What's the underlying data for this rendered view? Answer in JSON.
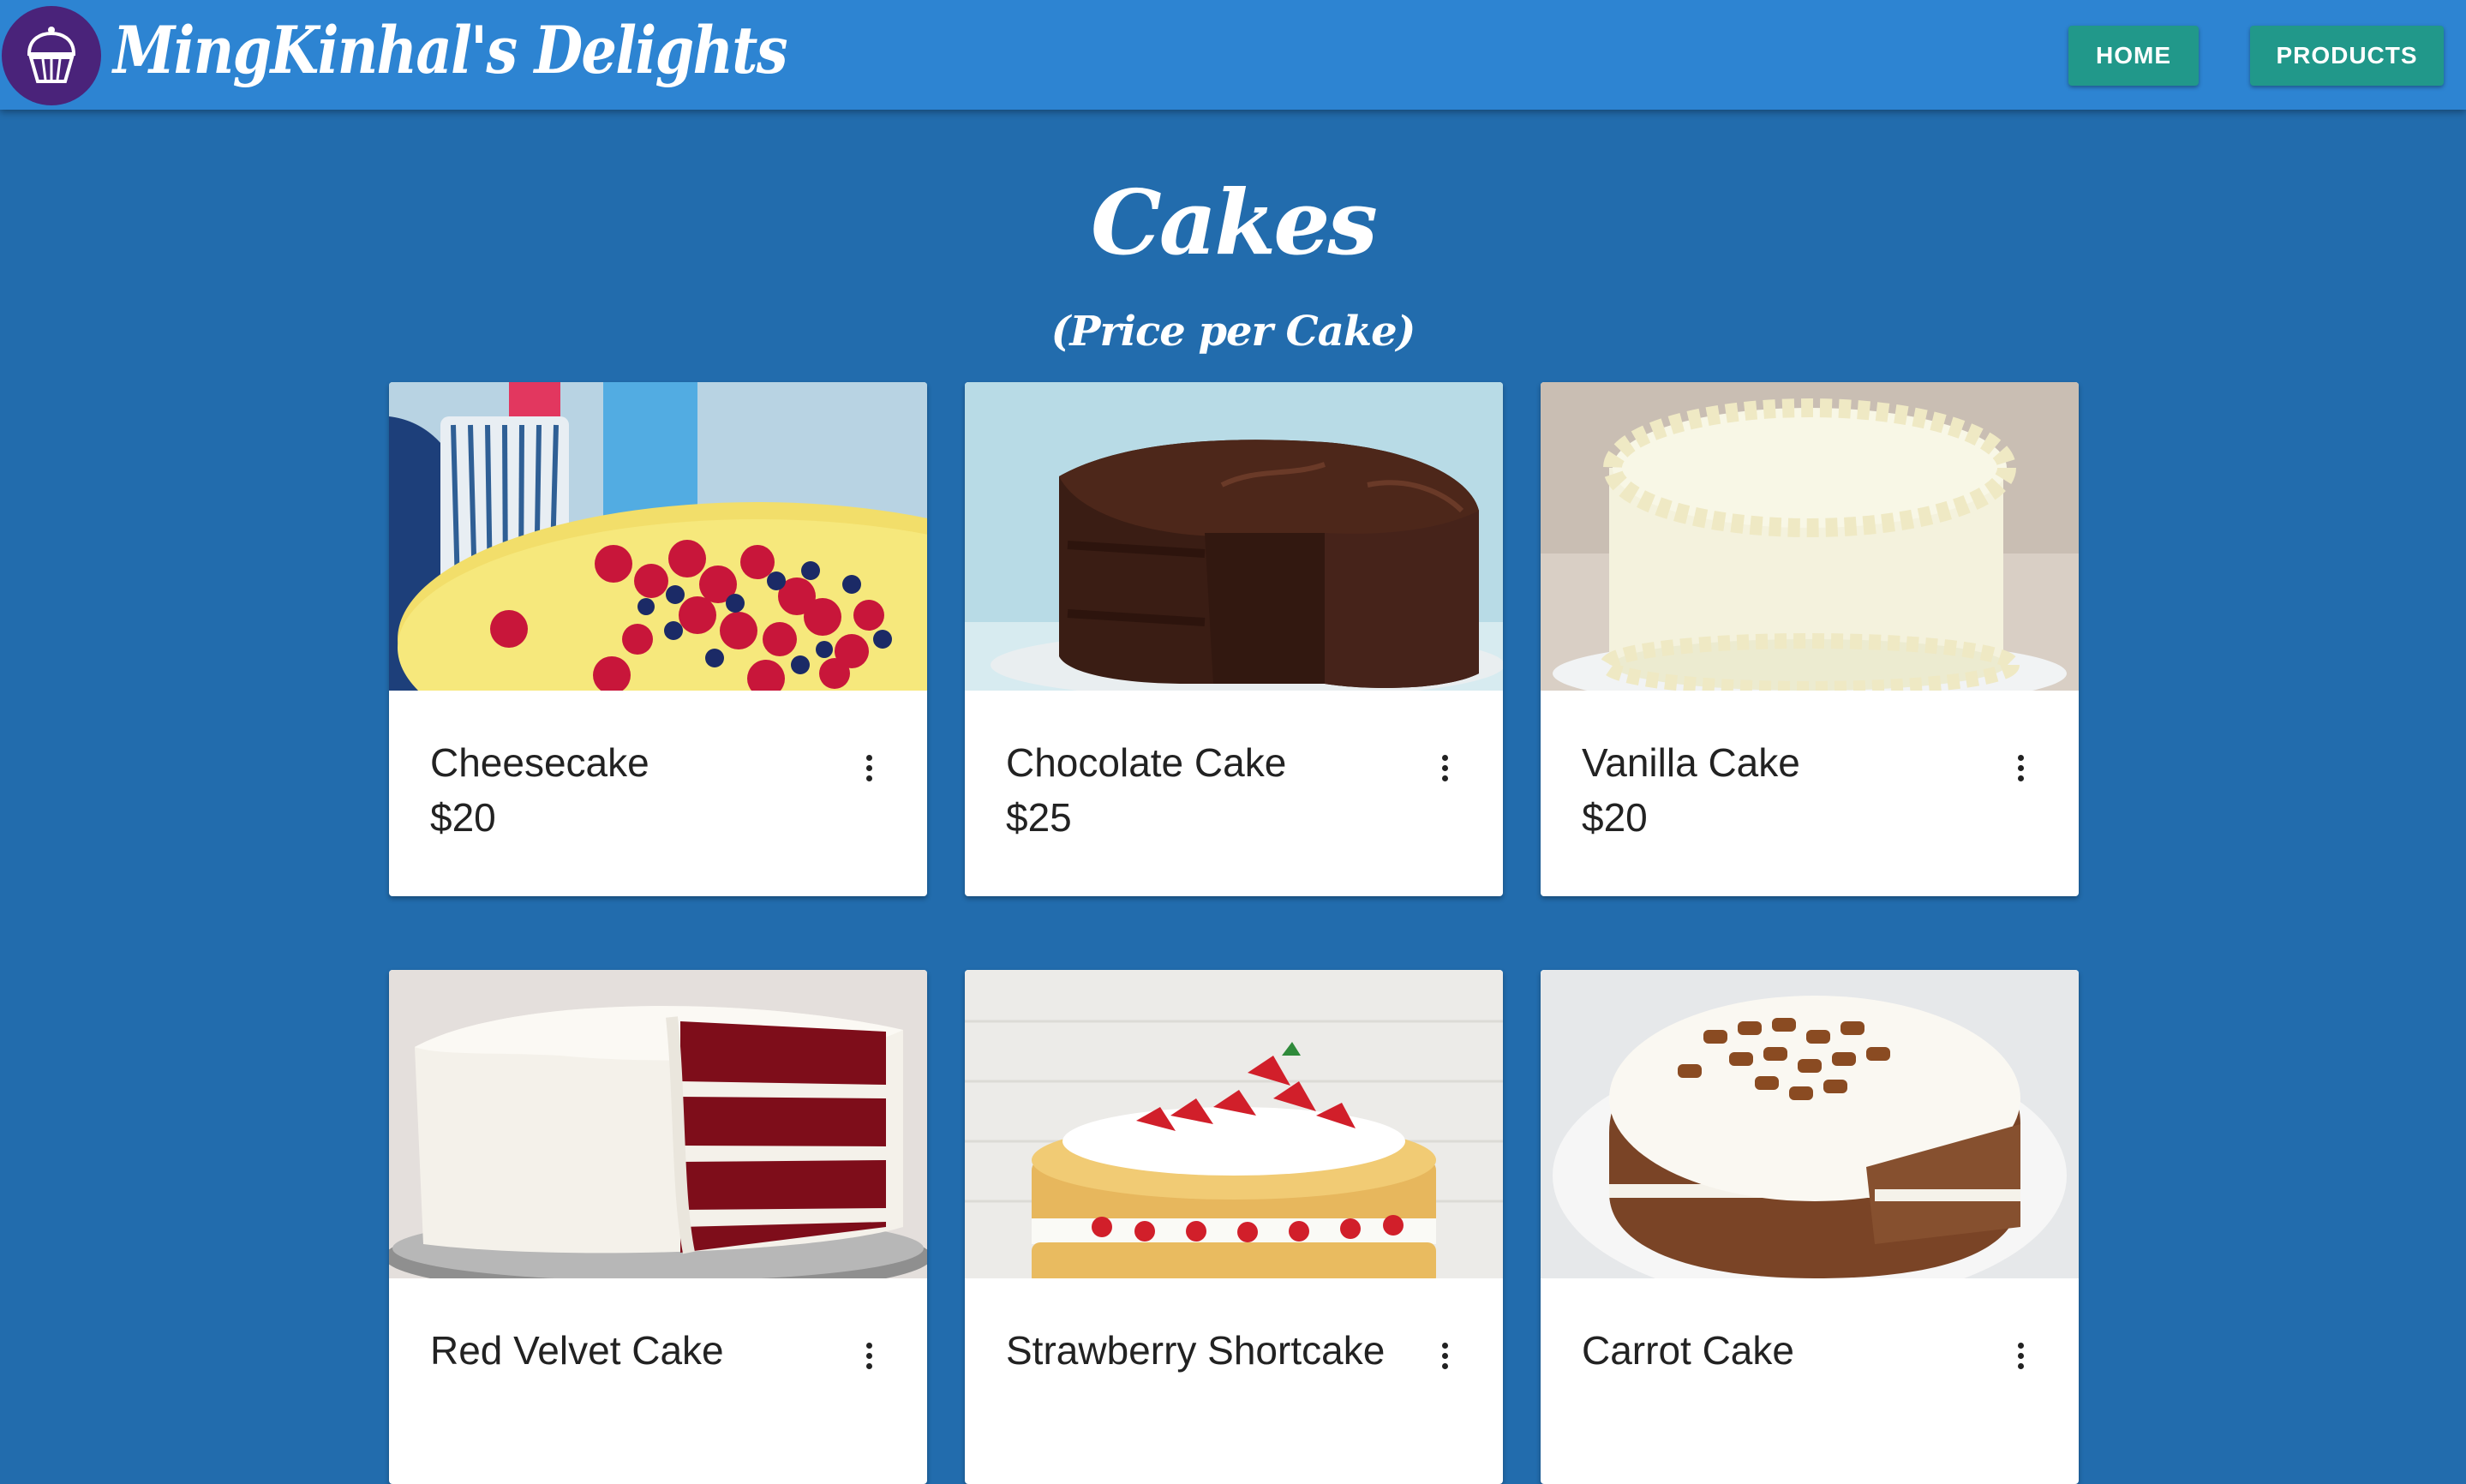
{
  "header": {
    "brand": "MingKinhal's Delights",
    "logo_icon": "cupcake-icon",
    "nav": [
      {
        "label": "HOME"
      },
      {
        "label": "PRODUCTS"
      }
    ]
  },
  "page": {
    "title": "Cakes",
    "subtitle": "(Price per Cake)"
  },
  "products": [
    {
      "name": "Cheesecake",
      "price": "$20",
      "menu_icon": "more-vert-icon"
    },
    {
      "name": "Chocolate Cake",
      "price": "$25",
      "menu_icon": "more-vert-icon"
    },
    {
      "name": "Vanilla Cake",
      "price": "$20",
      "menu_icon": "more-vert-icon"
    },
    {
      "name": "Red Velvet Cake",
      "price": "",
      "menu_icon": "more-vert-icon"
    },
    {
      "name": "Strawberry Shortcake",
      "price": "",
      "menu_icon": "more-vert-icon"
    },
    {
      "name": "Carrot Cake",
      "price": "",
      "menu_icon": "more-vert-icon"
    }
  ],
  "colors": {
    "page_background": "#226cad",
    "appbar": "#2d84d2",
    "button": "#21988a",
    "logo_circle": "#4a237a"
  }
}
